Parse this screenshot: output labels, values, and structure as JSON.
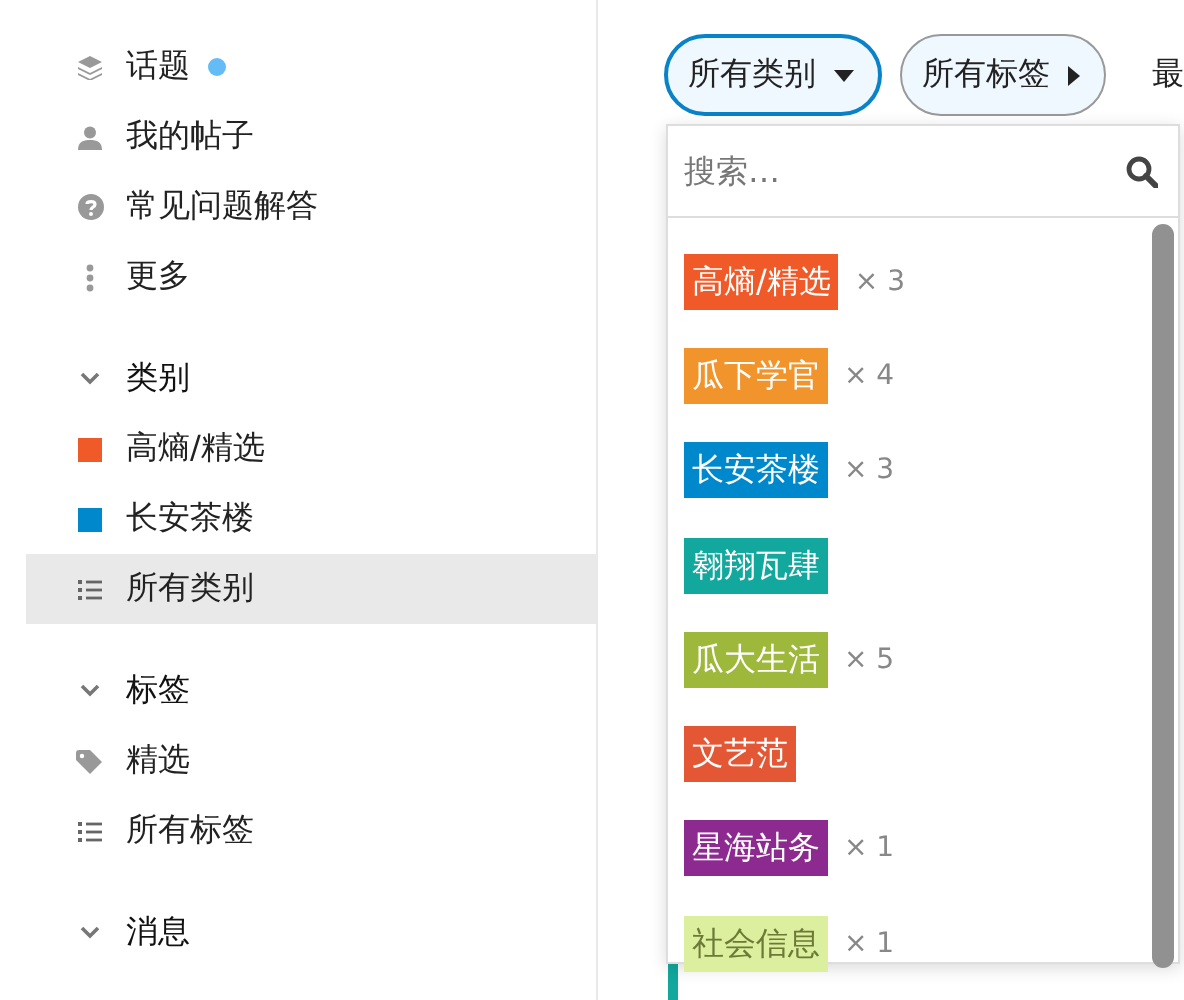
{
  "sidebar": {
    "links": [
      {
        "label": "话题",
        "kind": "layers",
        "unread_dot": true
      },
      {
        "label": "我的帖子",
        "kind": "user",
        "unread_dot": false
      },
      {
        "label": "常见问题解答",
        "kind": "question",
        "unread_dot": false
      },
      {
        "label": "更多",
        "kind": "dots",
        "unread_dot": false
      }
    ],
    "sections": [
      {
        "title": "类别",
        "expanded": true,
        "items": [
          {
            "label": "高熵/精选",
            "kind": "square",
            "color": "#f05a28",
            "selected": false
          },
          {
            "label": "长安茶楼",
            "kind": "square",
            "color": "#0088cc",
            "selected": false
          },
          {
            "label": "所有类别",
            "kind": "list",
            "selected": true
          }
        ]
      },
      {
        "title": "标签",
        "expanded": true,
        "items": [
          {
            "label": "精选",
            "kind": "tag",
            "selected": false
          },
          {
            "label": "所有标签",
            "kind": "list",
            "selected": false
          }
        ]
      },
      {
        "title": "消息",
        "expanded": true
      }
    ]
  },
  "filters": [
    {
      "label": "所有类别",
      "expanded": true
    },
    {
      "label": "所有标签",
      "expanded": false
    }
  ],
  "nav_cut": "最",
  "dropdown": {
    "search": {
      "placeholder": "搜索…"
    },
    "categories": [
      {
        "name": "高熵/精选",
        "color": "#f05a28",
        "count": "× 3"
      },
      {
        "name": "瓜下学官",
        "color": "#f1942b",
        "count": "× 4"
      },
      {
        "name": "长安茶楼",
        "color": "#0088cc",
        "count": "× 3"
      },
      {
        "name": "翱翔瓦肆",
        "color": "#12a89d"
      },
      {
        "name": "瓜大生活",
        "color": "#9eb83b",
        "count": "× 5"
      },
      {
        "name": "文艺范",
        "color": "#e45735"
      },
      {
        "name": "星海站务",
        "color": "#8c2a8f",
        "count": "× 1"
      },
      {
        "name": "社会信息",
        "color": "#dcef9f",
        "count": "× 1"
      }
    ]
  }
}
